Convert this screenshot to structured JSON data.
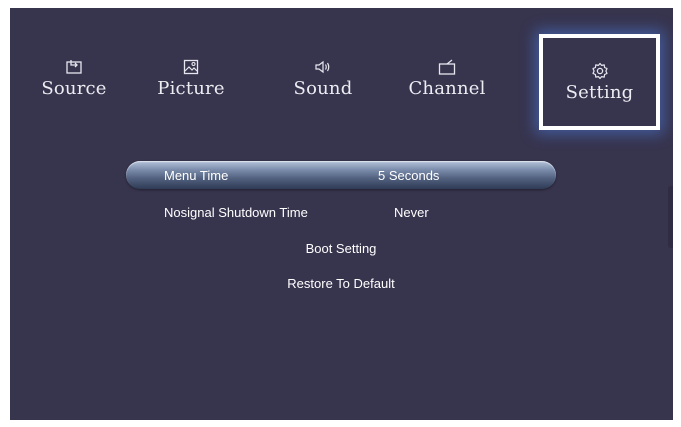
{
  "tabs": [
    {
      "label": "Source",
      "icon": "source-icon"
    },
    {
      "label": "Picture",
      "icon": "picture-icon"
    },
    {
      "label": "Sound",
      "icon": "sound-icon"
    },
    {
      "label": "Channel",
      "icon": "channel-icon"
    },
    {
      "label": "Setting",
      "icon": "gear-icon",
      "selected": true
    }
  ],
  "settings": {
    "menu_time": {
      "label": "Menu Time",
      "value": "5 Seconds"
    },
    "nosignal_shutdown": {
      "label": "Nosignal Shutdown Time",
      "value": "Never"
    },
    "boot_setting": {
      "label": "Boot Setting"
    },
    "restore_default": {
      "label": "Restore To Default"
    }
  },
  "colors": {
    "background": "#37344d",
    "selection_border": "#ffffff",
    "text": "#ffffff"
  }
}
